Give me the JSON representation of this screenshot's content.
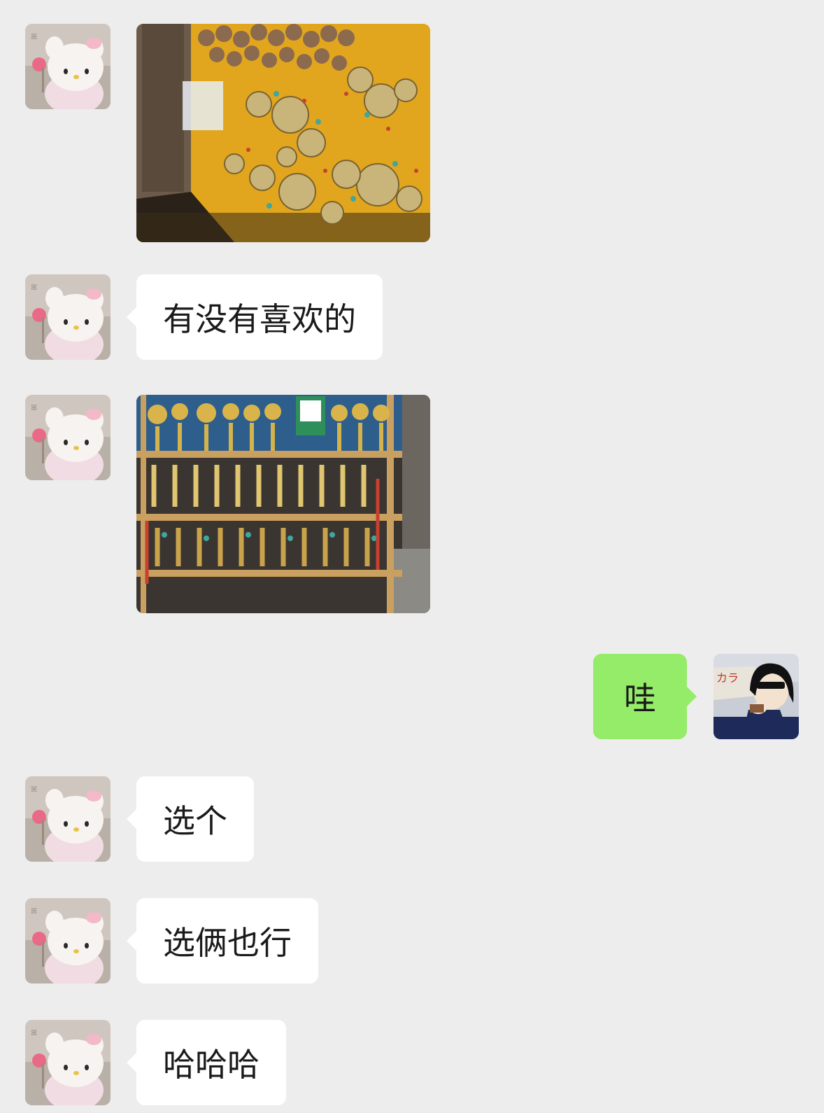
{
  "messages": [
    {
      "id": "m1",
      "side": "incoming",
      "kind": "image",
      "sender": "contact",
      "image": "market-stall-keychains-photo"
    },
    {
      "id": "m2",
      "side": "incoming",
      "kind": "text",
      "sender": "contact",
      "text": "有没有喜欢的"
    },
    {
      "id": "m3",
      "side": "incoming",
      "kind": "image",
      "sender": "contact",
      "image": "tassel-pendant-rack-photo"
    },
    {
      "id": "m4",
      "side": "outgoing",
      "kind": "text",
      "sender": "me",
      "text": "哇"
    },
    {
      "id": "m5",
      "side": "incoming",
      "kind": "text",
      "sender": "contact",
      "text": "选个"
    },
    {
      "id": "m6",
      "side": "incoming",
      "kind": "text",
      "sender": "contact",
      "text": "选俩也行"
    },
    {
      "id": "m7",
      "side": "incoming",
      "kind": "text",
      "sender": "contact",
      "text": "哈哈哈"
    }
  ],
  "avatars": {
    "contact": "hello-kitty-plush-avatar",
    "me": "anime-character-sunglasses-avatar"
  },
  "colors": {
    "background": "#EDEDED",
    "incoming_bubble": "#FFFFFF",
    "outgoing_bubble": "#95EC69"
  }
}
